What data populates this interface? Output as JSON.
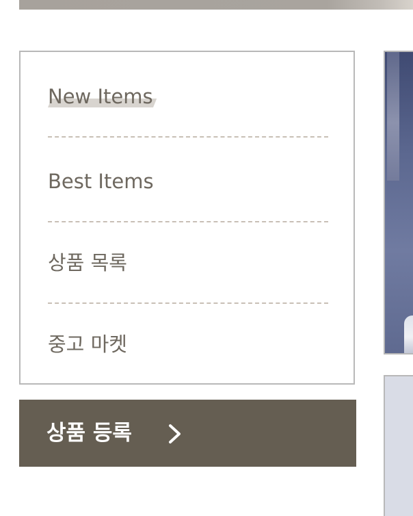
{
  "menu": {
    "items": [
      {
        "label": "New Items"
      },
      {
        "label": "Best Items"
      },
      {
        "label": "상품 목록"
      },
      {
        "label": "중고 마켓"
      }
    ]
  },
  "register_button": {
    "label": "상품 등록"
  },
  "colors": {
    "accent": "#655e52",
    "menu_text": "#6e685f",
    "divider": "#c8bfb5",
    "highlight": "#d8d4cf",
    "border": "#b8b8b8"
  },
  "icons": {
    "register_arrow": "chevron-right-icon"
  }
}
